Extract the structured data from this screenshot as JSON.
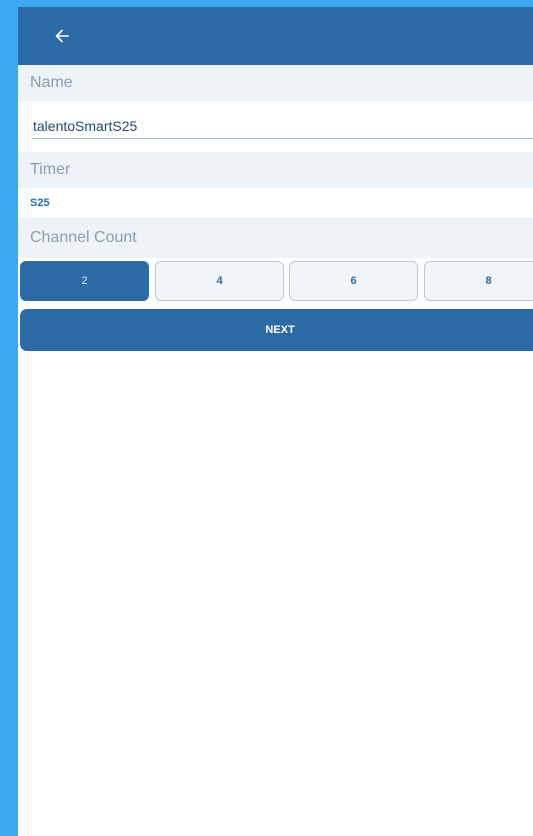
{
  "appbar": {
    "back_icon": "arrow-left-icon"
  },
  "form": {
    "name_label": "Name",
    "name_value": "talentoSmartS25",
    "timer_label": "Timer",
    "timer_value": "S25",
    "channel_count_label": "Channel Count",
    "channel_options": [
      "2",
      "4",
      "6",
      "8"
    ],
    "selected_channel": "2",
    "next_label": "NEXT"
  },
  "colors": {
    "primary": "#2b6aa5",
    "section_bg": "#eef3f8",
    "frame": "#3aa9f2"
  }
}
